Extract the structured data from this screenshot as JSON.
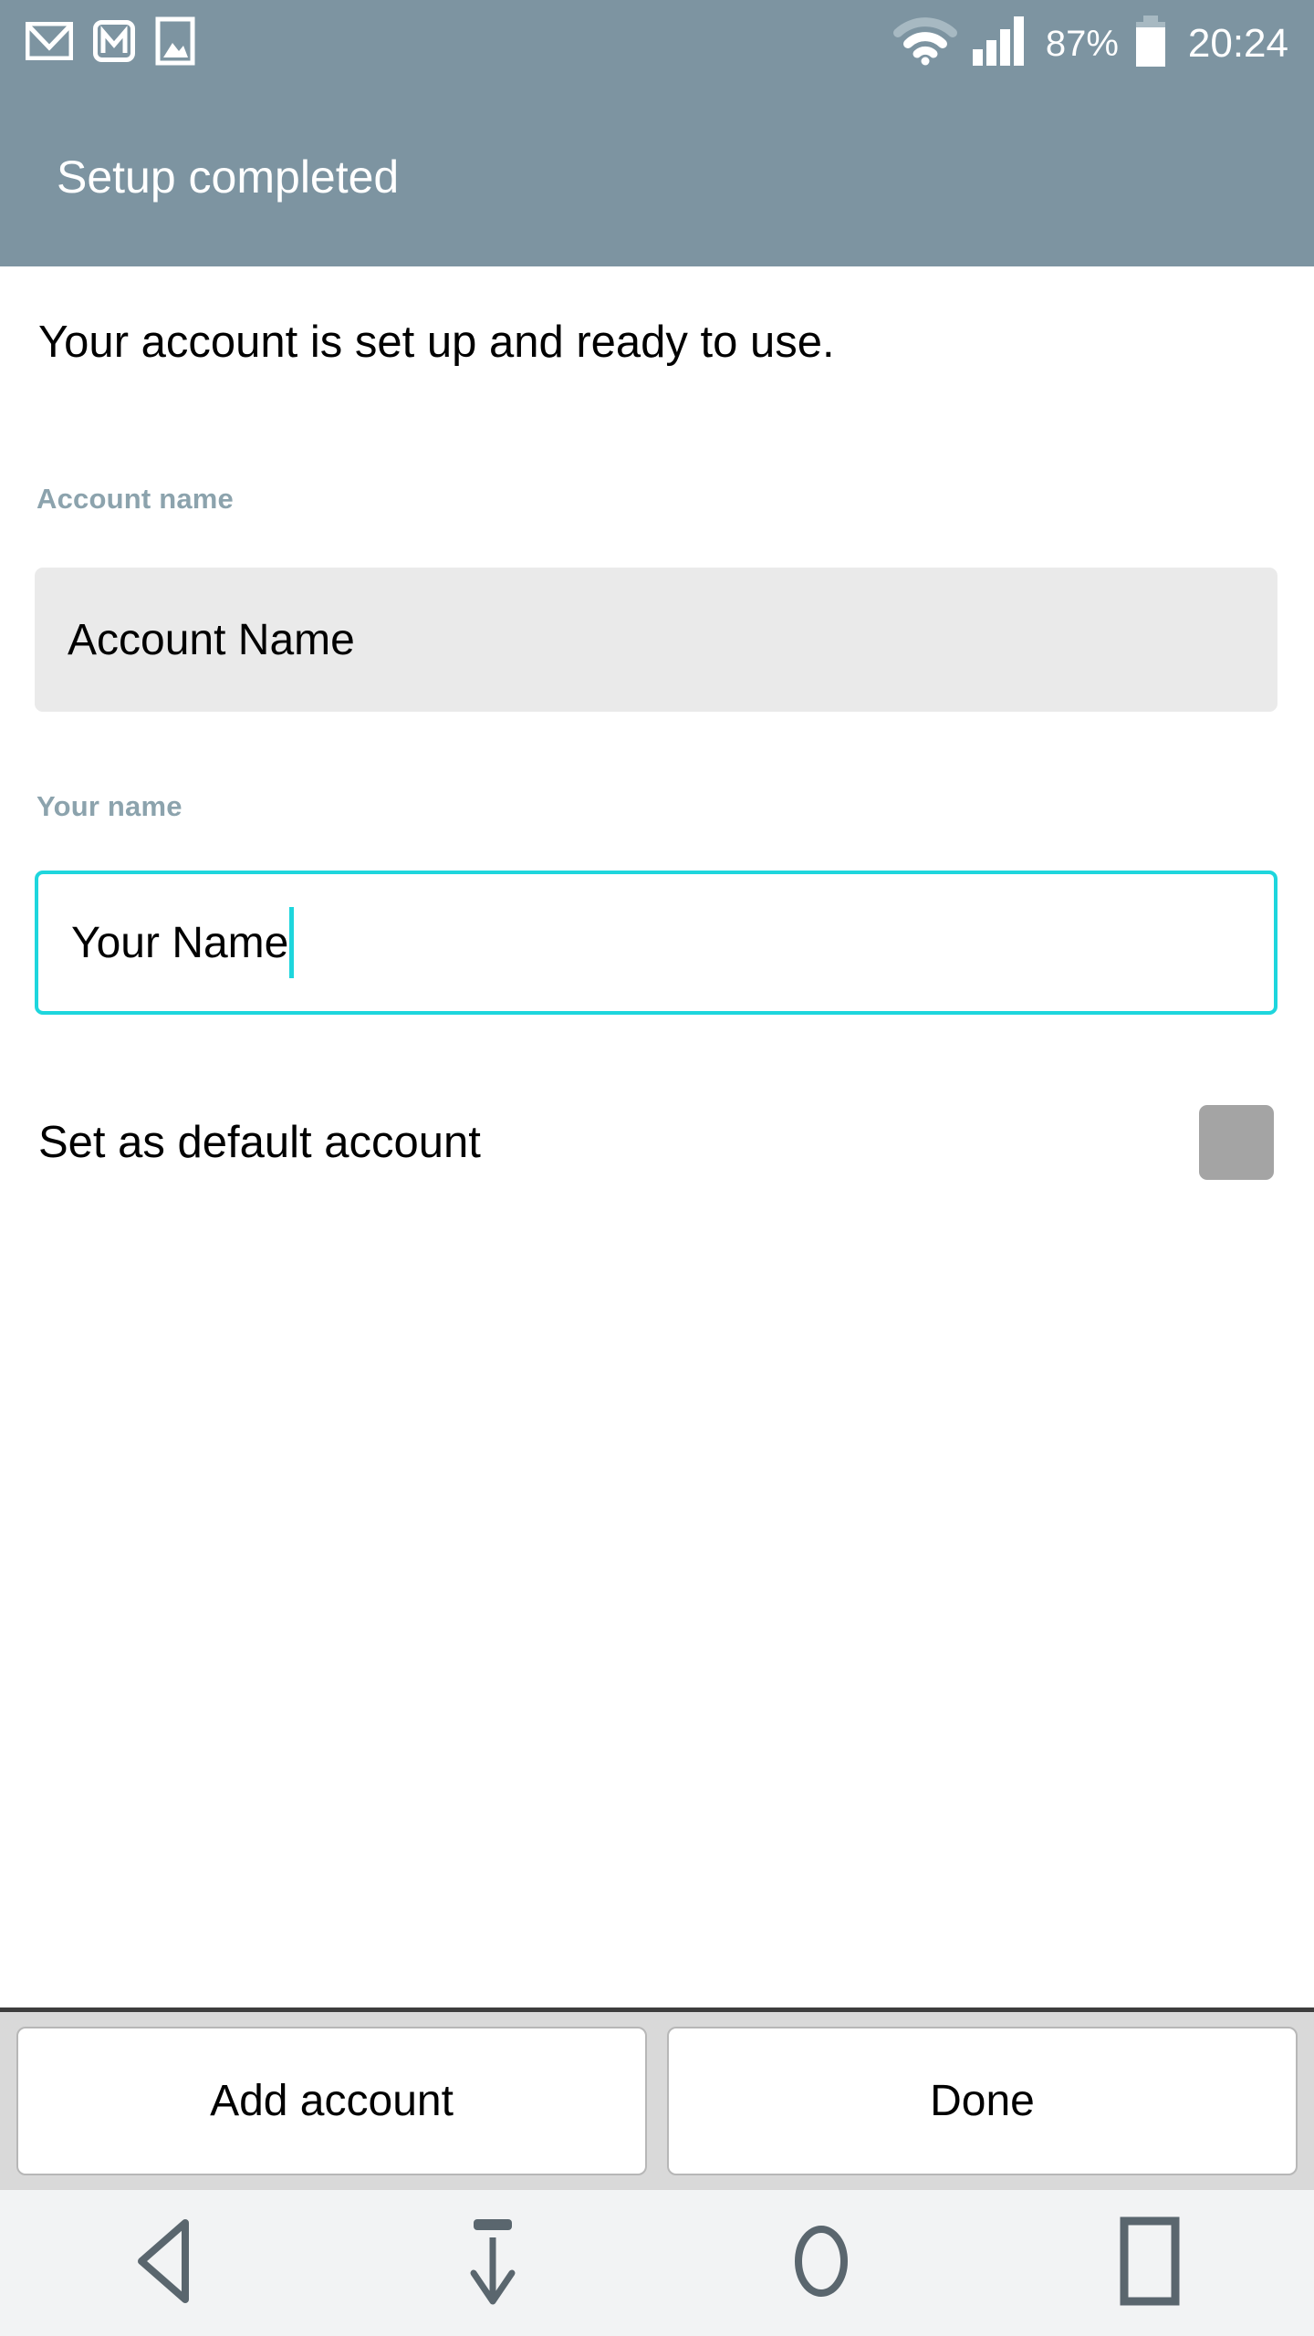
{
  "status_bar": {
    "left_icons": [
      {
        "name": "email-envelope-icon",
        "label": "Email"
      },
      {
        "name": "gmail-icon",
        "label": "Gmail"
      },
      {
        "name": "gallery-image-icon",
        "label": "Gallery"
      }
    ],
    "right_icons": [
      {
        "name": "wifi-icon",
        "label": "Wi-Fi connected"
      },
      {
        "name": "cellular-signal-icon",
        "label": "Signal full"
      },
      {
        "name": "battery-icon",
        "label": "Battery"
      }
    ],
    "battery_percent": "87%",
    "clock": "20:24",
    "background_color": "#7d94a1",
    "foreground_color": "#ffffff"
  },
  "title_bar": {
    "title": "Setup completed",
    "background_color": "#7d94a1"
  },
  "main": {
    "intro_text": "Your account is set up and ready to use.",
    "fields": [
      {
        "label": "Account name",
        "value": "Account Name",
        "placeholder": "Account name",
        "focused": false,
        "fill_color": "#eaeaea"
      },
      {
        "label": "Your name",
        "value": "Your Name",
        "placeholder": "Your name",
        "focused": true,
        "accent_color": "#1ed6dd"
      }
    ],
    "default_account": {
      "label": "Set as default account",
      "checked": false,
      "checkbox_color": "#a4a4a4"
    },
    "label_color": "#8ca3ad"
  },
  "button_bar": {
    "background_color": "#d9d9d9",
    "buttons": [
      {
        "name": "add-account-button",
        "label": "Add account"
      },
      {
        "name": "done-button",
        "label": "Done"
      }
    ]
  },
  "nav_bar": {
    "background_color": "#f2f3f4",
    "icon_color": "#5a666e",
    "buttons": [
      {
        "name": "back-button",
        "icon": "back-triangle-icon"
      },
      {
        "name": "hide-keyboard-button",
        "icon": "arrow-down-bar-icon"
      },
      {
        "name": "home-button",
        "icon": "home-circle-icon"
      },
      {
        "name": "recents-button",
        "icon": "recents-square-icon"
      }
    ]
  }
}
